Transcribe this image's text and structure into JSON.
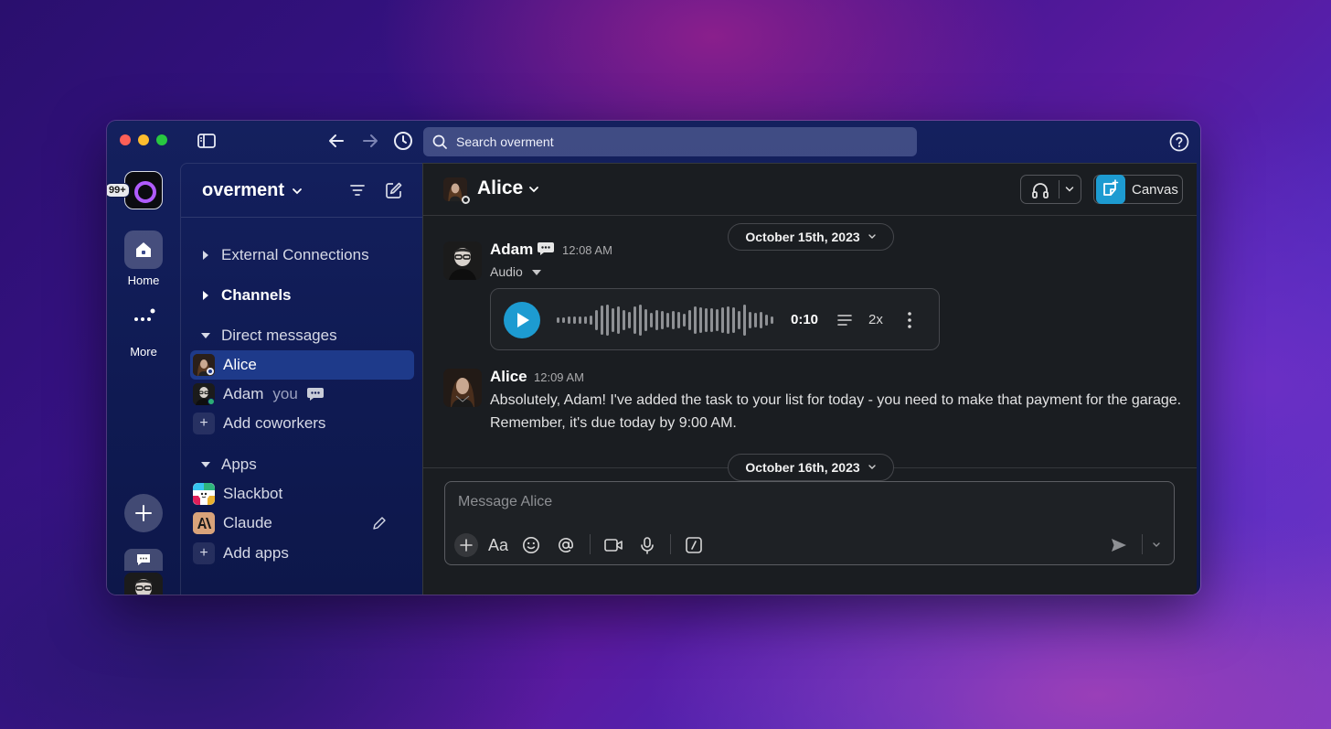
{
  "window": {
    "search_placeholder": "Search overment",
    "help_icon": "question-circle-icon"
  },
  "rail": {
    "badge": "99+",
    "home_label": "Home",
    "more_label": "More"
  },
  "sidebar": {
    "workspace_name": "overment",
    "sections": {
      "external": "External Connections",
      "channels": "Channels",
      "dms": "Direct messages",
      "apps": "Apps"
    },
    "dms": [
      {
        "name": "Alice",
        "active": true
      },
      {
        "name": "Adam",
        "suffix": "you"
      }
    ],
    "add_coworkers": "Add coworkers",
    "apps": [
      {
        "name": "Slackbot"
      },
      {
        "name": "Claude"
      }
    ],
    "add_apps": "Add apps"
  },
  "channel": {
    "title": "Alice",
    "canvas_label": "Canvas"
  },
  "messages": {
    "date1": "October 15th, 2023",
    "date2": "October 16th, 2023",
    "m1": {
      "author": "Adam",
      "time": "12:08 AM",
      "attachment_label": "Audio",
      "audio_duration": "0:10",
      "audio_speed": "2x"
    },
    "m2": {
      "author": "Alice",
      "time": "12:09 AM",
      "text": "Absolutely, Adam! I've added the task to your list for today - you need to make that payment for the garage. Remember, it's due today by 9:00 AM."
    }
  },
  "composer": {
    "placeholder": "Message Alice",
    "format_label": "Aa"
  },
  "colors": {
    "accent": "#1d9bd1",
    "sidebar_active": "#1e3a8a",
    "online": "#2bac76",
    "main_bg": "#1a1d21"
  }
}
